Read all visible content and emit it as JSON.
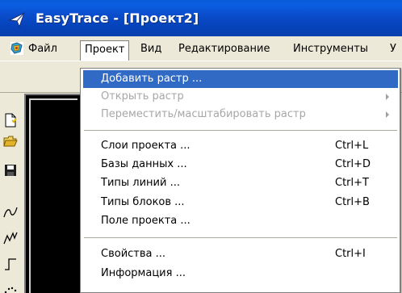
{
  "window": {
    "title": "EasyTrace - [Проект2]",
    "accent_color": "#0a4bc9",
    "icon": "easytrace-app-icon"
  },
  "menubar": {
    "items": [
      {
        "label": "Файл",
        "icon": "app-logo-icon"
      },
      {
        "label": "Проект",
        "open": true
      },
      {
        "label": "Вид"
      },
      {
        "label": "Редактирование"
      },
      {
        "label": "Инструменты"
      },
      {
        "label": "У"
      }
    ]
  },
  "dropdown": {
    "items": [
      {
        "label": "Добавить растр ...",
        "shortcut": "",
        "state": "selected"
      },
      {
        "label": "Открыть растр",
        "shortcut": "",
        "state": "disabled",
        "submenu": true
      },
      {
        "label": "Переместить/масштабировать растр",
        "shortcut": "",
        "state": "disabled",
        "submenu": true
      },
      {
        "label": "Слои проекта ...",
        "shortcut": "Ctrl+L",
        "state": "normal"
      },
      {
        "label": "Базы данных ...",
        "shortcut": "Ctrl+D",
        "state": "normal"
      },
      {
        "label": "Типы линий ...",
        "shortcut": "Ctrl+T",
        "state": "normal"
      },
      {
        "label": "Типы блоков ...",
        "shortcut": "Ctrl+B",
        "state": "normal"
      },
      {
        "label": "Поле проекта ...",
        "shortcut": "",
        "state": "normal"
      },
      {
        "label": "Свойства ...",
        "shortcut": "Ctrl+I",
        "state": "normal"
      },
      {
        "label": "Информация ...",
        "shortcut": "",
        "state": "normal"
      }
    ],
    "selected_color": "#316ac5",
    "disabled_color": "#a7a7a7"
  },
  "left_toolbar": {
    "tools": [
      "new-document-icon",
      "open-folder-icon",
      "save-disk-icon",
      "curve-tool-icon",
      "polyline-tool-icon",
      "orthogonal-line-tool-icon",
      "dotted-tool-icon"
    ]
  }
}
